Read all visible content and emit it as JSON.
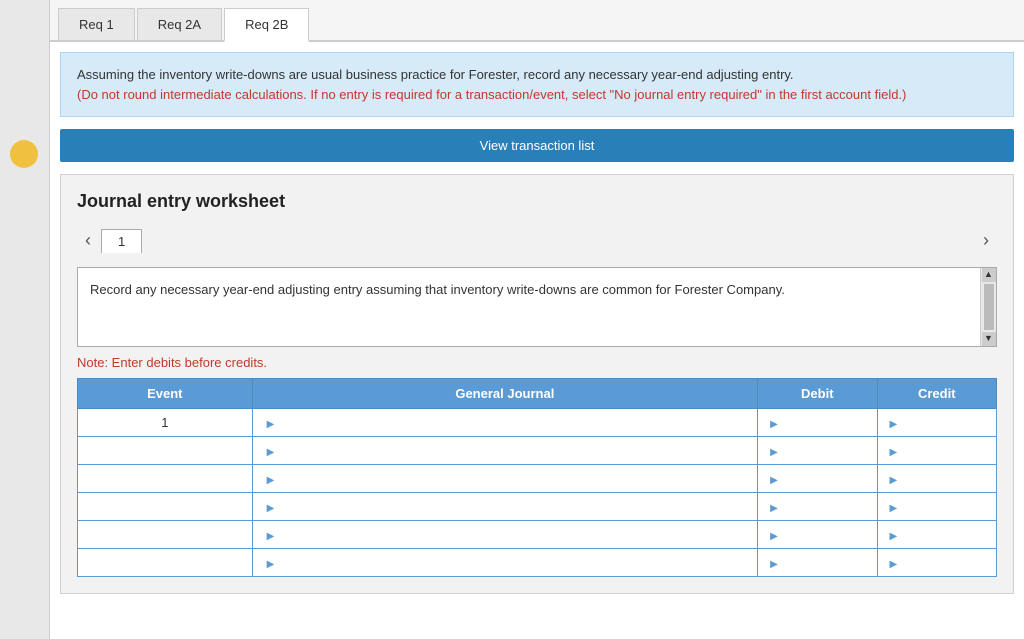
{
  "tabs": [
    {
      "label": "Req 1",
      "active": false
    },
    {
      "label": "Req 2A",
      "active": false
    },
    {
      "label": "Req 2B",
      "active": true
    }
  ],
  "info_box": {
    "main_text": "Assuming the inventory write-downs are usual business practice for Forester, record any necessary year-end adjusting entry.",
    "red_text": "(Do not round intermediate calculations. If no entry is required for a transaction/event, select \"No journal entry required\" in the first account field.)"
  },
  "view_transaction_button": "View transaction list",
  "journal": {
    "title": "Journal entry worksheet",
    "page_number": "1",
    "description": "Record any necessary year-end adjusting entry assuming that inventory write-downs are common for Forester Company.",
    "note": "Note: Enter debits before credits.",
    "table": {
      "headers": [
        "Event",
        "General Journal",
        "Debit",
        "Credit"
      ],
      "rows": [
        {
          "event": "1",
          "gj": "",
          "debit": "",
          "credit": ""
        },
        {
          "event": "",
          "gj": "",
          "debit": "",
          "credit": ""
        },
        {
          "event": "",
          "gj": "",
          "debit": "",
          "credit": ""
        },
        {
          "event": "",
          "gj": "",
          "debit": "",
          "credit": ""
        },
        {
          "event": "",
          "gj": "",
          "debit": "",
          "credit": ""
        },
        {
          "event": "",
          "gj": "",
          "debit": "",
          "credit": ""
        }
      ]
    }
  }
}
